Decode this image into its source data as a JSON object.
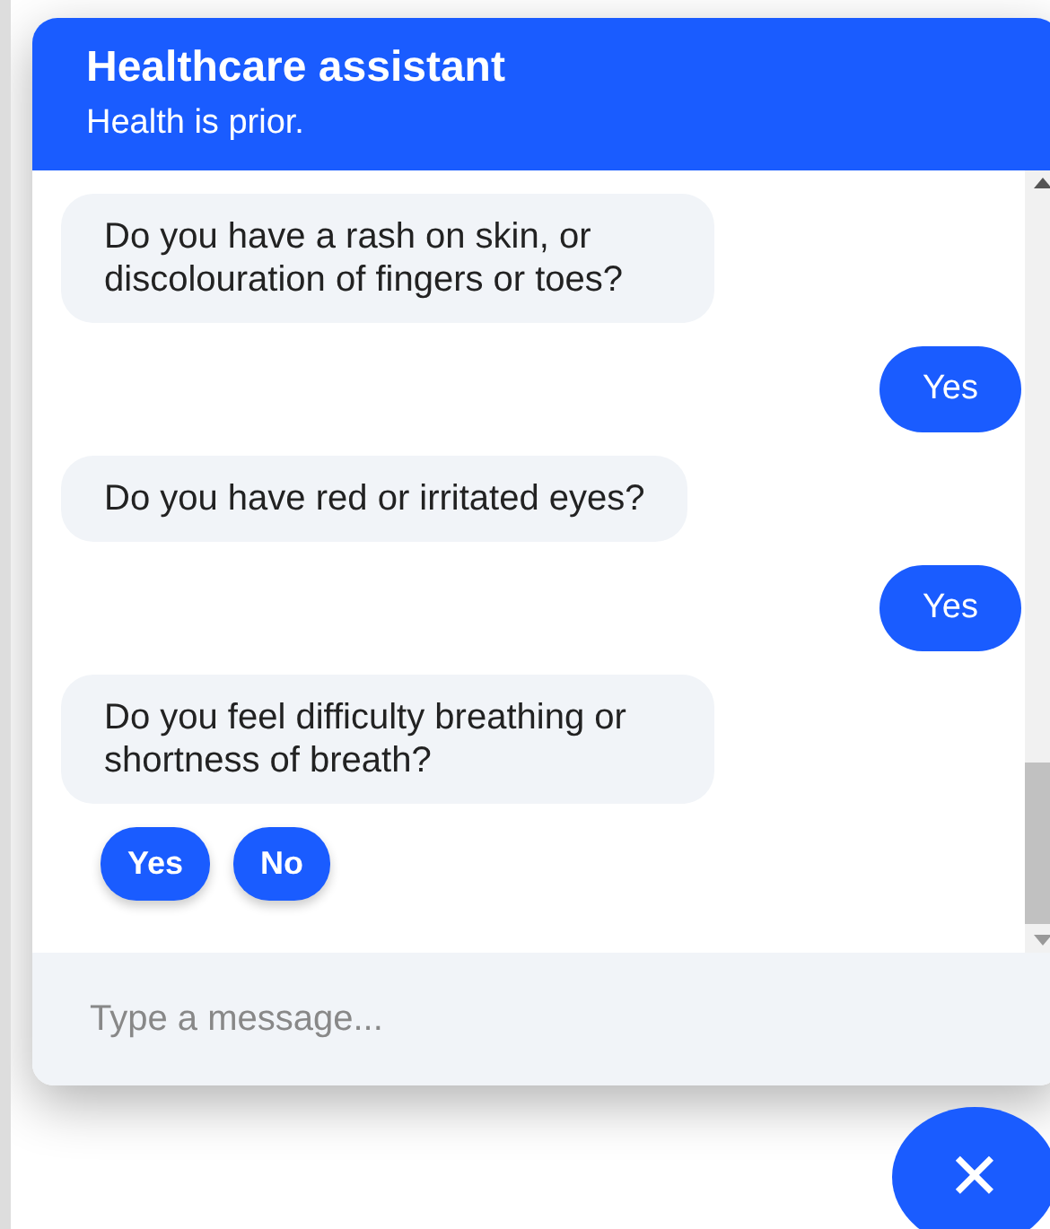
{
  "header": {
    "title": "Healthcare assistant",
    "subtitle": "Health is prior."
  },
  "messages": [
    {
      "kind": "bot",
      "text": "Do you have a rash on skin, or discolouration of fingers or toes?"
    },
    {
      "kind": "user",
      "text": "Yes"
    },
    {
      "kind": "bot",
      "text": "Do you have red or irritated eyes?"
    },
    {
      "kind": "user",
      "text": "Yes"
    },
    {
      "kind": "bot",
      "text": "Do you feel difficulty breathing or shortness of breath?"
    }
  ],
  "quick_replies": [
    "Yes",
    "No"
  ],
  "composer": {
    "placeholder": "Type a message..."
  },
  "close_button": {
    "label": "✕"
  }
}
